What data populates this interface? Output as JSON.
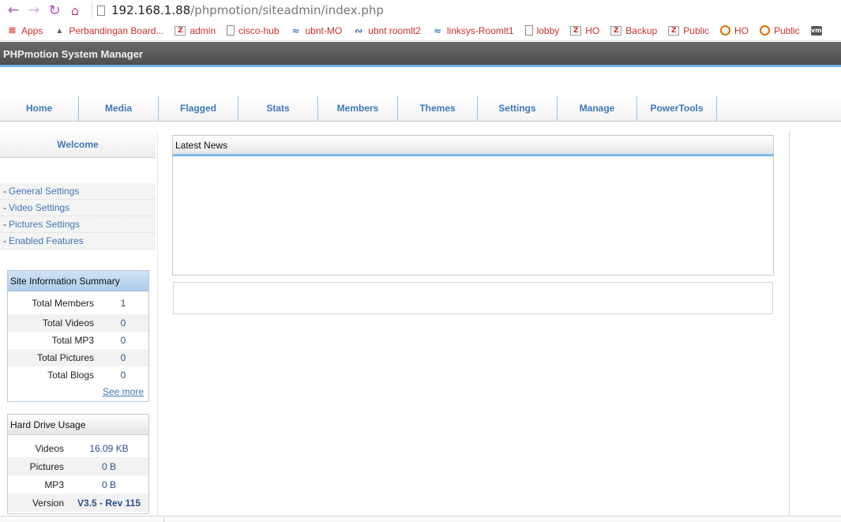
{
  "browser": {
    "address_host": "192.168.1.88",
    "address_path": "/phpmotion/siteadmin/index.php",
    "bookmarks": [
      {
        "label": "Apps",
        "icon": "apps-grid-icon"
      },
      {
        "label": "Perbandingan Board...",
        "icon": "site-favicon-icon"
      },
      {
        "label": "admin",
        "icon": "zeroshell-icon"
      },
      {
        "label": "cisco-hub",
        "icon": "page-icon"
      },
      {
        "label": "ubnt-MO",
        "icon": "feed-icon"
      },
      {
        "label": "ubnt roomlt2",
        "icon": "ubnt-icon"
      },
      {
        "label": "linksys-Roomlt1",
        "icon": "feed-icon"
      },
      {
        "label": "lobby",
        "icon": "page-icon"
      },
      {
        "label": "HO",
        "icon": "zeroshell-icon"
      },
      {
        "label": "Backup",
        "icon": "zeroshell-icon"
      },
      {
        "label": "Public",
        "icon": "zeroshell-icon"
      },
      {
        "label": "HO",
        "icon": "ring-icon"
      },
      {
        "label": "Public",
        "icon": "ring-icon"
      },
      {
        "label": "",
        "icon": "vmware-icon"
      }
    ]
  },
  "app": {
    "title": "PHPmotion System Manager"
  },
  "tabs": [
    "Home",
    "Media",
    "Flagged",
    "Stats",
    "Members",
    "Themes",
    "Settings",
    "Manage",
    "PowerTools"
  ],
  "sidebar": {
    "welcome": "Welcome",
    "links": [
      {
        "prefix": "-",
        "label": "General Settings"
      },
      {
        "prefix": "-",
        "label": "Video Settings"
      },
      {
        "prefix": "-",
        "label": "Pictures Settings"
      },
      {
        "prefix": "-",
        "label": "Enabled Features"
      }
    ],
    "site_summary": {
      "title": "Site Information Summary",
      "rows": [
        {
          "label": "Total Members",
          "value": "1"
        },
        {
          "label": "Total Videos",
          "value": "0"
        },
        {
          "label": "Total MP3",
          "value": "0"
        },
        {
          "label": "Total Pictures",
          "value": "0"
        },
        {
          "label": "Total Blogs",
          "value": "0"
        }
      ],
      "see_more": "See more"
    },
    "hard_drive": {
      "title": "Hard Drive Usage",
      "rows": [
        {
          "label": "Videos",
          "value": "16.09 KB"
        },
        {
          "label": "Pictures",
          "value": "0 B"
        },
        {
          "label": "MP3",
          "value": "0 B"
        },
        {
          "label": "Version",
          "value": "V3.5 - Rev 115"
        }
      ]
    }
  },
  "main": {
    "latest_news_title": "Latest News"
  }
}
